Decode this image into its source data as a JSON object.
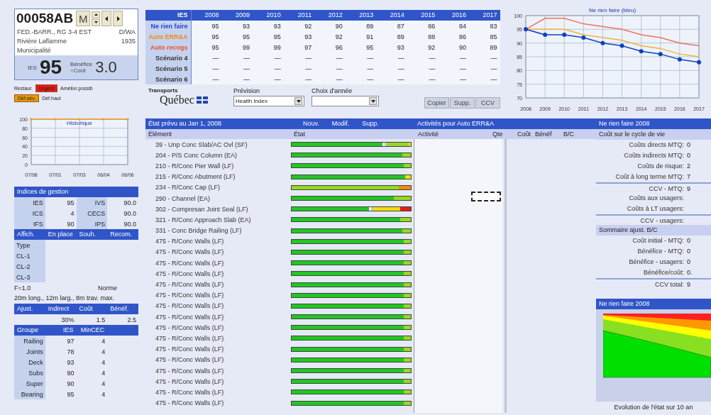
{
  "bridge": {
    "id": "00058AB",
    "mode_button": "M",
    "road": "FED.-BARR., RG 3-4 EST",
    "code": "D/WA",
    "river": "Rivière Laflamme",
    "year": "1935",
    "owner": "Municipalité",
    "ies_label": "IES",
    "ies": "95",
    "ratio_label": [
      "Bénéfice",
      "÷Coût"
    ],
    "ratio": "3.0"
  },
  "flags": [
    {
      "label": "Restaur.",
      "badge": "Urgent",
      "color": "#e81818",
      "note": "Amélior.possib"
    },
    {
      "badge": "Déf.sév.",
      "color": "#e89a00",
      "note": "Déf.haut"
    }
  ],
  "history": {
    "chart_data": {
      "type": "line",
      "title": "Historique",
      "categories": [
        "07/98",
        "07/01",
        "07/03",
        "06/04",
        "06/06"
      ],
      "series": [
        {
          "color": "#f0a020",
          "marker": true,
          "values": [
            100,
            100,
            100,
            100,
            100
          ]
        }
      ],
      "ylim": [
        0,
        100
      ],
      "yticks": [
        0,
        20,
        40,
        60,
        80,
        100
      ],
      "grid": true
    }
  },
  "indices": {
    "title": "Indices de gestion",
    "rows": [
      [
        "IES",
        "95",
        "IVS",
        "90.0"
      ],
      [
        "ICS",
        "4",
        "CECS",
        "90.0"
      ],
      [
        "IFS",
        "90",
        "IPS",
        "90.0"
      ]
    ]
  },
  "display_table": {
    "columns": [
      "Affich.",
      "En place",
      "Souh.",
      "Recom."
    ],
    "rows": [
      "Type",
      "CL-1",
      "CL-2",
      "CL-3"
    ]
  },
  "load": {
    "factor": "F=1.0",
    "standard": "Norme",
    "limits": "20m long., 12m larg., 8m trav. max."
  },
  "adjust": {
    "columns": [
      "Ajust.",
      "Indirect",
      "Coût",
      "Bénéf."
    ],
    "values": [
      "30%",
      "1.5",
      "2.5"
    ]
  },
  "groups": {
    "columns": [
      "Groupe",
      "IES",
      "MinCEC"
    ],
    "rows": [
      [
        "Railing",
        "97",
        "4"
      ],
      [
        "Joints",
        "78",
        "4"
      ],
      [
        "Deck",
        "93",
        "4"
      ],
      [
        "Subs",
        "90",
        "4"
      ],
      [
        "Super",
        "90",
        "4"
      ],
      [
        "Bearing",
        "95",
        "4"
      ]
    ]
  },
  "scenarios": {
    "columns": [
      "IES",
      "2008",
      "2009",
      "2010",
      "2011",
      "2012",
      "2013",
      "2014",
      "2015",
      "2016",
      "2017"
    ],
    "rows": [
      {
        "name": "Ne rien faire",
        "color": "#2244cc",
        "values": [
          "95",
          "93",
          "93",
          "92",
          "90",
          "89",
          "87",
          "86",
          "84",
          "83"
        ]
      },
      {
        "name": "Auto ERR&A",
        "color": "#f08a10",
        "values": [
          "95",
          "95",
          "95",
          "93",
          "92",
          "91",
          "89",
          "88",
          "86",
          "85"
        ]
      },
      {
        "name": "Auto recogs",
        "color": "#f05030",
        "values": [
          "95",
          "99",
          "99",
          "97",
          "96",
          "95",
          "93",
          "92",
          "90",
          "89"
        ]
      },
      {
        "name": "Scénario 4",
        "color": "#333333",
        "values": [
          "—",
          "—",
          "—",
          "—",
          "—",
          "—",
          "—",
          "—",
          "—",
          "—"
        ]
      },
      {
        "name": "Scénario 5",
        "color": "#333333",
        "values": [
          "—",
          "—",
          "—",
          "—",
          "—",
          "—",
          "—",
          "—",
          "—",
          "—"
        ]
      },
      {
        "name": "Scénario 6",
        "color": "#333333",
        "values": [
          "—",
          "—",
          "—",
          "—",
          "—",
          "—",
          "—",
          "—",
          "—",
          "—"
        ]
      }
    ]
  },
  "forecast": {
    "logo_top": "Transports",
    "logo": "Québec",
    "prevision_label": "Prévision",
    "prevision_value": "Health Index",
    "year_label": "Choix d'année",
    "buttons": [
      "Copier",
      "Supp.",
      "CCV"
    ]
  },
  "trend": {
    "chart_data": {
      "type": "line",
      "title": "Ne rien faire (bleu)",
      "x": [
        "2008",
        "2009",
        "2010",
        "2011",
        "2012",
        "2013",
        "2014",
        "2015",
        "2016",
        "2017"
      ],
      "ylim": [
        70,
        100
      ],
      "yticks": [
        70,
        75,
        80,
        85,
        90,
        95,
        100
      ],
      "grid": true,
      "series": [
        {
          "color": "#f07060",
          "marker": false,
          "values": [
            95,
            99,
            99,
            97,
            96,
            95,
            93,
            92,
            90,
            89
          ]
        },
        {
          "color": "#f0b040",
          "marker": false,
          "values": [
            95,
            95,
            95,
            93,
            92,
            91,
            89,
            88,
            86,
            85
          ]
        },
        {
          "color": "#1040c0",
          "marker": true,
          "values": [
            95,
            93,
            93,
            92,
            90,
            89,
            87,
            86,
            84,
            83
          ]
        }
      ]
    }
  },
  "elements": {
    "title": "État prévu au Jan 1, 2008",
    "actions": [
      "Nouv.",
      "Modif.",
      "Supp."
    ],
    "activities_title": "Activités pour Auto ERR&A",
    "columns": [
      "Élément",
      "État",
      "Activité",
      "Qte",
      "Coût",
      "Bénéf",
      "B/C"
    ],
    "rows": [
      {
        "name": "39 - Unp Conc Slab/AC Ovl (SF)",
        "segments": [
          {
            "color": "#20c820",
            "level": 0.76
          },
          {
            "color": "#98d820"
          },
          {
            "color": "#f0e000",
            "level": 0.02
          }
        ]
      },
      {
        "name": "204 - P/S Conc Column (EA)",
        "segments": [
          {
            "color": "#20c820",
            "level": 0.93
          },
          {
            "color": "#98d820",
            "level": 0.07
          }
        ]
      },
      {
        "name": "210 - R/Conc Pier Wall (LF)",
        "segments": [
          {
            "color": "#20c820",
            "level": 0.94
          },
          {
            "color": "#98d820",
            "level": 0.06
          }
        ]
      },
      {
        "name": "215 - R/Conc Abutment (LF)",
        "segments": [
          {
            "color": "#20c820",
            "level": 0.95
          },
          {
            "color": "#f0e000",
            "level": 0.05
          }
        ]
      },
      {
        "name": "234 - R/Conc Cap (LF)",
        "segments": [
          {
            "color": "#98d820",
            "level": 0.9
          },
          {
            "color": "#f08a10",
            "level": 0.1
          }
        ]
      },
      {
        "name": "290 - Channel (EA)",
        "segments": [
          {
            "color": "#20c820",
            "level": 0.86
          },
          {
            "color": "#98d820",
            "level": 0.14
          }
        ]
      },
      {
        "name": "302 - Compresan Joint Seal (LF)",
        "segments": [
          {
            "color": "#20c820",
            "level": 0.65
          },
          {
            "color": "#f0e000"
          },
          {
            "color": "#e81818",
            "level": 0.09
          }
        ]
      },
      {
        "name": "321 - R/Conc Approach Slab (EA)",
        "segments": [
          {
            "color": "#20c820",
            "level": 0.91
          },
          {
            "color": "#98d820",
            "level": 0.09
          }
        ]
      },
      {
        "name": "331 - Conc Bridge Railing (LF)",
        "segments": [
          {
            "color": "#20c820",
            "level": 0.93
          },
          {
            "color": "#98d820",
            "level": 0.07
          }
        ]
      },
      {
        "name": "475 - R/Conc Walls (LF)",
        "segments": [
          {
            "color": "#20c820",
            "level": 0.94
          },
          {
            "color": "#98d820",
            "level": 0.06
          }
        ]
      },
      {
        "name": "475 - R/Conc Walls (LF)",
        "segments": [
          {
            "color": "#20c820",
            "level": 0.94
          },
          {
            "color": "#98d820",
            "level": 0.06
          }
        ]
      },
      {
        "name": "475 - R/Conc Walls (LF)",
        "segments": [
          {
            "color": "#20c820",
            "level": 0.94
          },
          {
            "color": "#98d820",
            "level": 0.06
          }
        ]
      },
      {
        "name": "475 - R/Conc Walls (LF)",
        "segments": [
          {
            "color": "#20c820",
            "level": 0.94
          },
          {
            "color": "#98d820",
            "level": 0.06
          }
        ]
      },
      {
        "name": "475 - R/Conc Walls (LF)",
        "segments": [
          {
            "color": "#20c820",
            "level": 0.94
          },
          {
            "color": "#98d820",
            "level": 0.06
          }
        ]
      },
      {
        "name": "475 - R/Conc Walls (LF)",
        "segments": [
          {
            "color": "#20c820",
            "level": 0.94
          },
          {
            "color": "#98d820",
            "level": 0.06
          }
        ]
      },
      {
        "name": "475 - R/Conc Walls (LF)",
        "segments": [
          {
            "color": "#20c820",
            "level": 0.94
          },
          {
            "color": "#98d820",
            "level": 0.06
          }
        ]
      },
      {
        "name": "475 - R/Conc Walls (LF)",
        "segments": [
          {
            "color": "#20c820",
            "level": 0.94
          },
          {
            "color": "#98d820",
            "level": 0.06
          }
        ]
      },
      {
        "name": "475 - R/Conc Walls (LF)",
        "segments": [
          {
            "color": "#20c820",
            "level": 0.94
          },
          {
            "color": "#98d820",
            "level": 0.06
          }
        ]
      },
      {
        "name": "475 - R/Conc Walls (LF)",
        "segments": [
          {
            "color": "#20c820",
            "level": 0.94
          },
          {
            "color": "#98d820",
            "level": 0.06
          }
        ]
      },
      {
        "name": "475 - R/Conc Walls (LF)",
        "segments": [
          {
            "color": "#20c820",
            "level": 0.94
          },
          {
            "color": "#98d820",
            "level": 0.06
          }
        ]
      },
      {
        "name": "475 - R/Conc Walls (LF)",
        "segments": [
          {
            "color": "#20c820",
            "level": 0.94
          },
          {
            "color": "#98d820",
            "level": 0.06
          }
        ]
      },
      {
        "name": "475 - R/Conc Walls (LF)",
        "segments": [
          {
            "color": "#20c820",
            "level": 0.94
          },
          {
            "color": "#98d820",
            "level": 0.06
          }
        ]
      },
      {
        "name": "475 - R/Conc Walls (LF)",
        "segments": [
          {
            "color": "#20c820",
            "level": 0.94
          },
          {
            "color": "#98d820",
            "level": 0.06
          }
        ]
      },
      {
        "name": "475 - R/Conc Walls (LF)",
        "segments": [
          {
            "color": "#20c820",
            "level": 0.94
          },
          {
            "color": "#98d820",
            "level": 0.06
          }
        ]
      },
      {
        "name": "475 - R/Conc Walls (LF)",
        "segments": [
          {
            "color": "#20c820",
            "level": 0.94
          },
          {
            "color": "#98d820",
            "level": 0.06
          }
        ]
      }
    ]
  },
  "summary": {
    "title": "Ne rien faire 2008",
    "sections": [
      {
        "title": "Coût sur le cycle de vie",
        "rows": [
          {
            "label": "Coûts directs MTQ:",
            "value": "0",
            "total": false
          },
          {
            "label": "Coûts indirects MTQ:",
            "value": "0",
            "total": false
          },
          {
            "label": "Coûts de risque:",
            "value": "2",
            "total": false
          },
          {
            "label": "Coût à long terme MTQ:",
            "value": "7",
            "total": false
          },
          {
            "label": "CCV - MTQ:",
            "value": "9",
            "total": true
          },
          {
            "label": "Coûts aux usagers:",
            "total": false
          },
          {
            "label": "Coûts à LT usagers:",
            "total": false
          },
          {
            "label": "CCV - usagers:",
            "total": true
          }
        ]
      },
      {
        "title": "Sommaire ajust. B/C",
        "rows": [
          {
            "label": "Coût initial - MTQ:",
            "value": "0",
            "total": false
          },
          {
            "label": "Bénéfice - MTQ:",
            "value": "0",
            "total": false
          },
          {
            "label": "Bénéfice - usagers:",
            "value": "0",
            "total": false
          },
          {
            "label": "Bénéfice/coût:",
            "value": "0.",
            "total": false
          },
          {
            "label": "CCV total:",
            "value": "9",
            "total": true
          }
        ]
      }
    ]
  },
  "evolution": {
    "title": "Ne rien faire 2008",
    "caption": "Evolution de l'état sur 10 an"
  }
}
